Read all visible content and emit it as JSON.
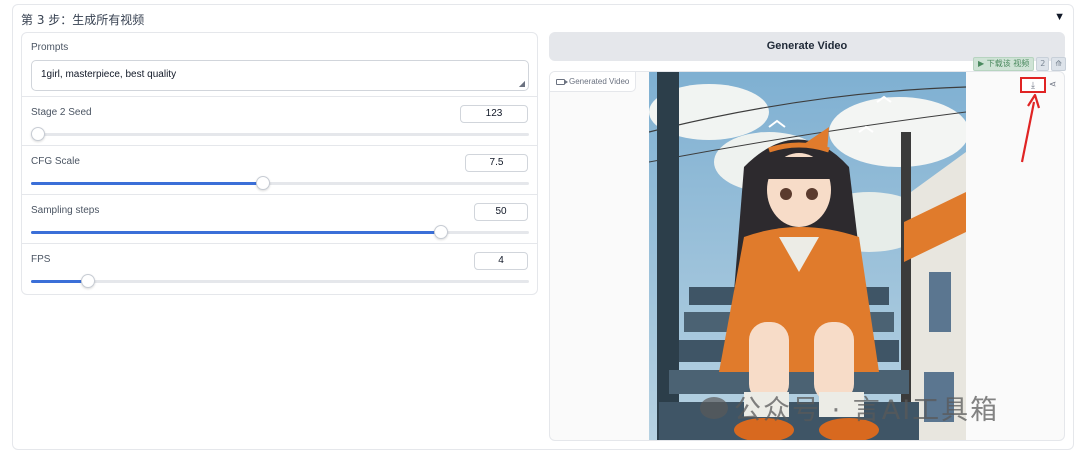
{
  "step": {
    "title": "第 3 步：生成所有视频",
    "collapse_icon": "triangle-down-icon"
  },
  "prompt": {
    "label": "Prompts",
    "value": "1girl, masterpiece, best quality"
  },
  "sliders": [
    {
      "label": "Stage 2 Seed",
      "value": "123",
      "fraction": 0.0
    },
    {
      "label": "CFG Scale",
      "value": "7.5",
      "fraction": 0.465
    },
    {
      "label": "Sampling steps",
      "value": "50",
      "fraction": 0.823
    },
    {
      "label": "FPS",
      "value": "4",
      "fraction": 0.114
    }
  ],
  "generate_button": "Generate Video",
  "video": {
    "label": "Generated Video",
    "download_icon": "download-icon",
    "share_icon": "share-icon"
  },
  "download_strip": {
    "label": "▶ 下载该 视频",
    "extra_1": "2",
    "extra_2": "⟰"
  },
  "watermark": "公众号 · 言AI工具箱",
  "colors": {
    "accent": "#3b6fd8",
    "highlight": "#e02424"
  }
}
